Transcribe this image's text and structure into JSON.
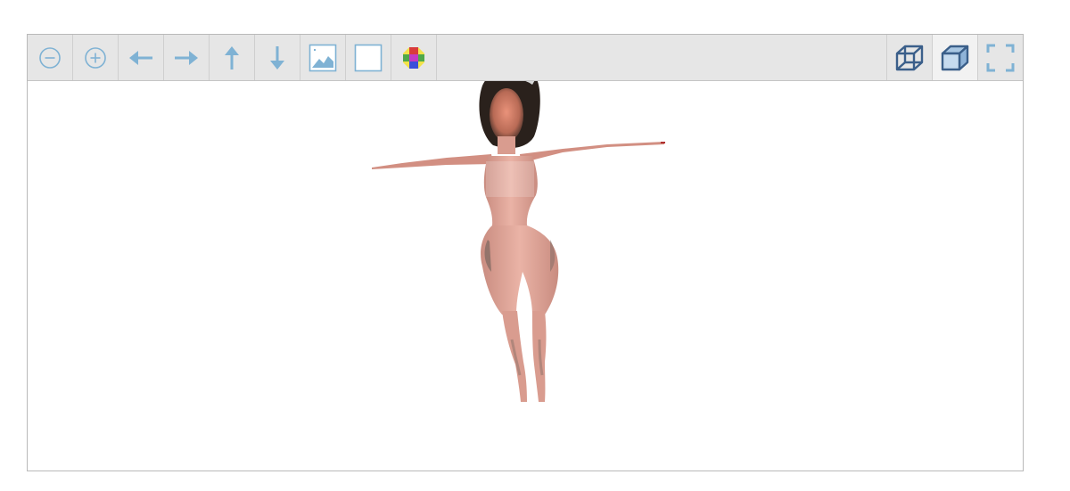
{
  "viewer": {
    "toolbar_left": [
      {
        "icon": "zoom-out-icon"
      },
      {
        "icon": "zoom-in-icon"
      },
      {
        "icon": "pan-left-icon"
      },
      {
        "icon": "pan-right-icon"
      },
      {
        "icon": "pan-up-icon"
      },
      {
        "icon": "pan-down-icon"
      },
      {
        "icon": "image-snapshot-icon"
      },
      {
        "icon": "background-toggle-icon"
      },
      {
        "icon": "color-cube-icon"
      }
    ],
    "toolbar_right": [
      {
        "icon": "wireframe-cube-icon"
      },
      {
        "icon": "solid-cube-icon",
        "active": true
      },
      {
        "icon": "fullscreen-icon"
      }
    ],
    "model": {
      "name": "human-figure-t-pose",
      "skin_color": "#e3a99b",
      "hair_color": "#2a211c"
    },
    "colors": {
      "icon_blue": "#7fb2d4",
      "cube_blue": "#3b5f8a",
      "toolbar_bg": "#e6e6e6"
    }
  }
}
